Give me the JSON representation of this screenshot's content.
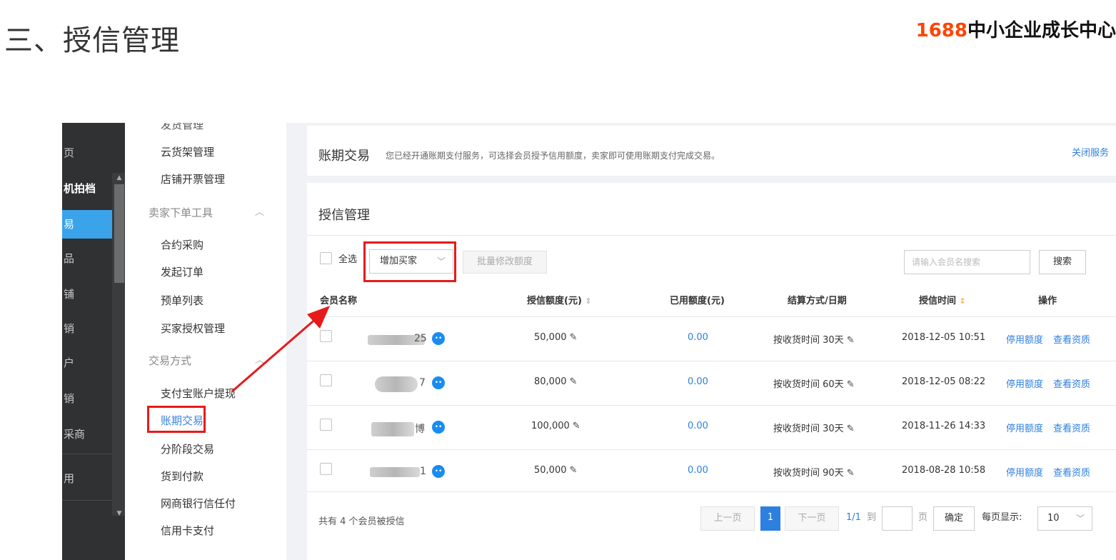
{
  "slide": {
    "title": "三、授信管理",
    "brand_number": "1688",
    "brand_text": "中小企业成长中心"
  },
  "dark_nav": {
    "items": [
      {
        "label": "页"
      },
      {
        "label": "机拍档"
      },
      {
        "label": "易"
      },
      {
        "label": "品"
      },
      {
        "label": "铺"
      },
      {
        "label": "销"
      },
      {
        "label": "户"
      },
      {
        "label": "销"
      },
      {
        "label": "采商"
      },
      {
        "label": "用"
      }
    ]
  },
  "sub_nav": {
    "top_partial": "发货管理",
    "items_a": [
      "云货架管理",
      "店铺开票管理"
    ],
    "group1": "卖家下单工具",
    "items_b": [
      "合约采购",
      "发起订单",
      "预单列表",
      "买家授权管理"
    ],
    "group2": "交易方式",
    "items_c": [
      "支付宝账户提现",
      "账期交易",
      "分阶段交易",
      "货到付款",
      "网商银行信任付",
      "信用卡支付"
    ]
  },
  "account_period": {
    "title": "账期交易",
    "description": "您已经开通账期支付服务，可选择会员授予信用额度，卖家即可使用账期支付完成交易。",
    "close_link": "关闭服务"
  },
  "credit": {
    "title": "授信管理",
    "select_all": "全选",
    "add_buyer": "增加买家",
    "batch_modify": "批量修改额度",
    "search_placeholder": "请输入会员名搜索",
    "search_button": "搜索",
    "columns": {
      "member": "会员名称",
      "credit_limit": "授信额度(元)",
      "used": "已用额度(元)",
      "settlement": "结算方式/日期",
      "time": "授信时间",
      "ops": "操作"
    },
    "rows": [
      {
        "name_suffix": "25",
        "limit": "50,000",
        "used": "0.00",
        "settle": "按收货时间 30天",
        "time": "2018-12-05 10:51",
        "op1": "停用额度",
        "op2": "查看资质"
      },
      {
        "name_suffix": "7",
        "limit": "80,000",
        "used": "0.00",
        "settle": "按收货时间 60天",
        "time": "2018-12-05 08:22",
        "op1": "停用额度",
        "op2": "查看资质"
      },
      {
        "name_suffix": "博",
        "limit": "100,000",
        "used": "0.00",
        "settle": "按收货时间 30天",
        "time": "2018-11-26 14:33",
        "op1": "停用额度",
        "op2": "查看资质"
      },
      {
        "name_suffix": "1",
        "limit": "50,000",
        "used": "0.00",
        "settle": "按收货时间 90天",
        "time": "2018-08-28 10:58",
        "op1": "停用额度",
        "op2": "查看资质"
      }
    ],
    "footer": {
      "total": "共有 4 个会员被授信",
      "prev": "上一页",
      "current_page": "1",
      "next": "下一页",
      "page_info": "1/1",
      "to": "到",
      "page_unit": "页",
      "confirm": "确定",
      "per_page_label": "每页显示:",
      "per_page": "10"
    }
  },
  "colors": {
    "accent": "#3aa3ea",
    "link": "#2d7fe0",
    "highlight": "#e8191a",
    "brand": "#ff4400"
  }
}
